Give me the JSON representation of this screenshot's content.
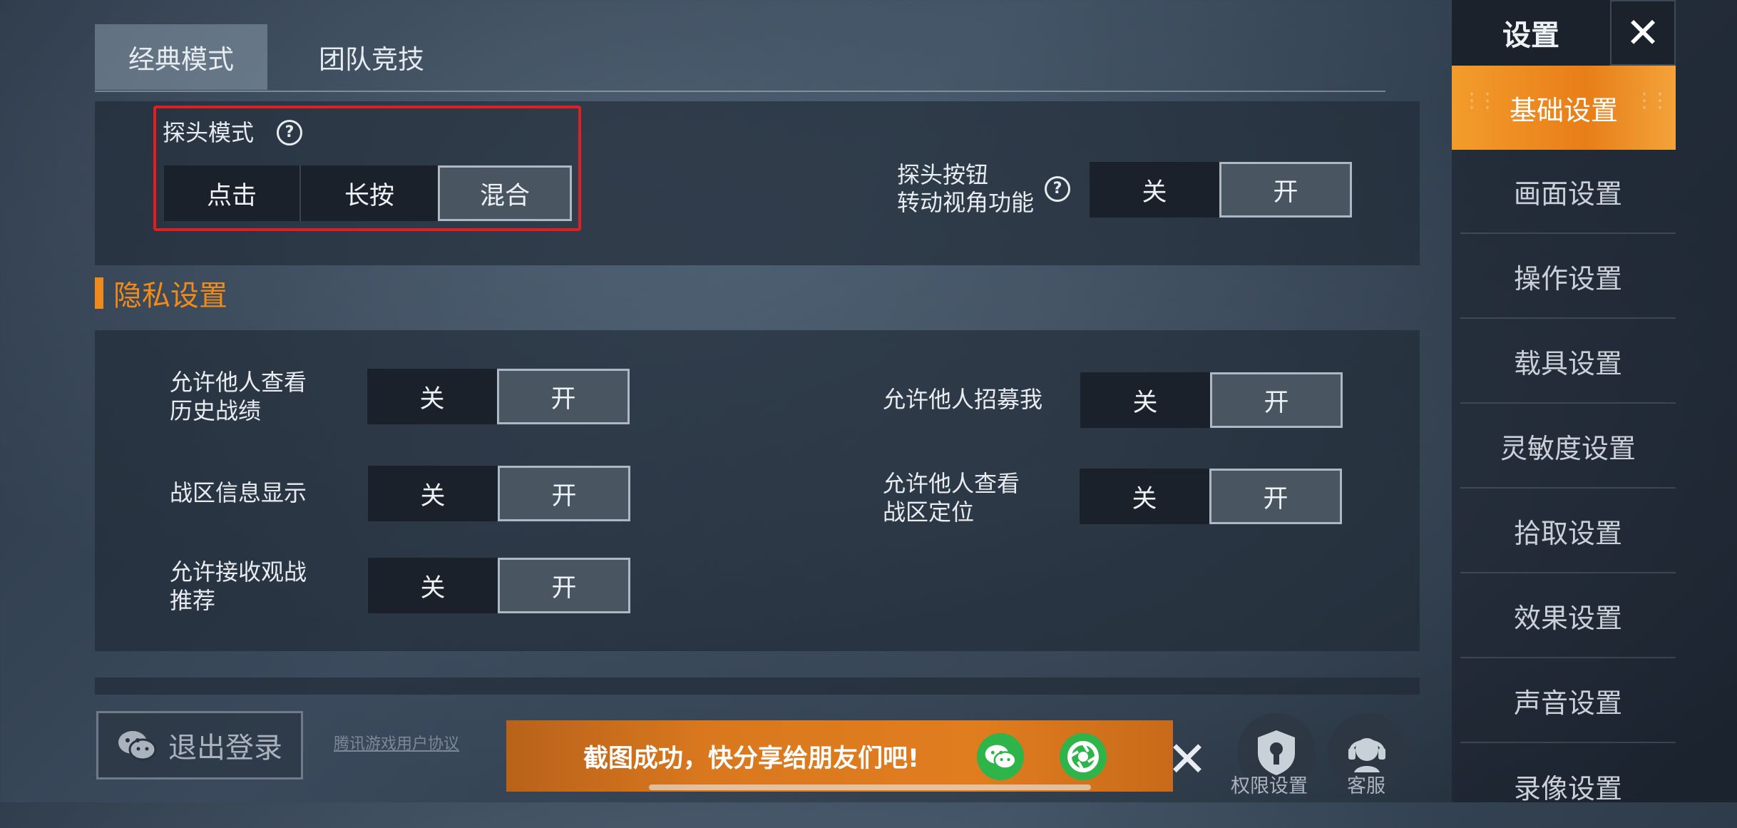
{
  "tabs": [
    {
      "label": "经典模式",
      "active": true
    },
    {
      "label": "团队竞技",
      "active": false
    }
  ],
  "peek": {
    "mode_label": "探头模式",
    "help_glyph": "?",
    "mode_options": [
      "点击",
      "长按",
      "混合"
    ],
    "mode_selected": "混合",
    "button_label_line1": "探头按钮",
    "button_label_line2": "转动视角功能",
    "button_toggle": {
      "off": "关",
      "on": "开",
      "selected": "开"
    }
  },
  "privacy": {
    "title": "隐私设置",
    "rows": [
      {
        "line1": "允许他人查看",
        "line2": "历史战绩",
        "off": "关",
        "on": "开",
        "selected": "开"
      },
      {
        "line1": "允许他人招募我",
        "line2": "",
        "off": "关",
        "on": "开",
        "selected": "开"
      },
      {
        "line1": "战区信息显示",
        "line2": "",
        "off": "关",
        "on": "开",
        "selected": "开"
      },
      {
        "line1": "允许他人查看",
        "line2": "战区定位",
        "off": "关",
        "on": "开",
        "selected": "开"
      },
      {
        "line1": "允许接收观战",
        "line2": "推荐",
        "off": "关",
        "on": "开",
        "selected": "开"
      }
    ]
  },
  "sidebar": {
    "title": "设置",
    "close_glyph": "✕",
    "items": [
      {
        "label": "基础设置",
        "active": true
      },
      {
        "label": "画面设置"
      },
      {
        "label": "操作设置"
      },
      {
        "label": "载具设置"
      },
      {
        "label": "灵敏度设置"
      },
      {
        "label": "拾取设置"
      },
      {
        "label": "效果设置"
      },
      {
        "label": "声音设置"
      },
      {
        "label": "录像设置"
      }
    ]
  },
  "bottom": {
    "logout_label": "退出登录",
    "agreement_label": "腾讯游戏用户协议",
    "toast_text": "截图成功，快分享给朋友们吧!",
    "close_glyph": "✕",
    "permission_label": "权限设置",
    "service_label": "客服"
  },
  "colors": {
    "accent": "#f08a1a",
    "highlight_box": "#e02020",
    "share_green": "#2fb44a"
  },
  "icons": [
    "help-icon",
    "close-icon",
    "wechat-icon",
    "moments-icon",
    "permission-icon",
    "customer-service-icon"
  ]
}
